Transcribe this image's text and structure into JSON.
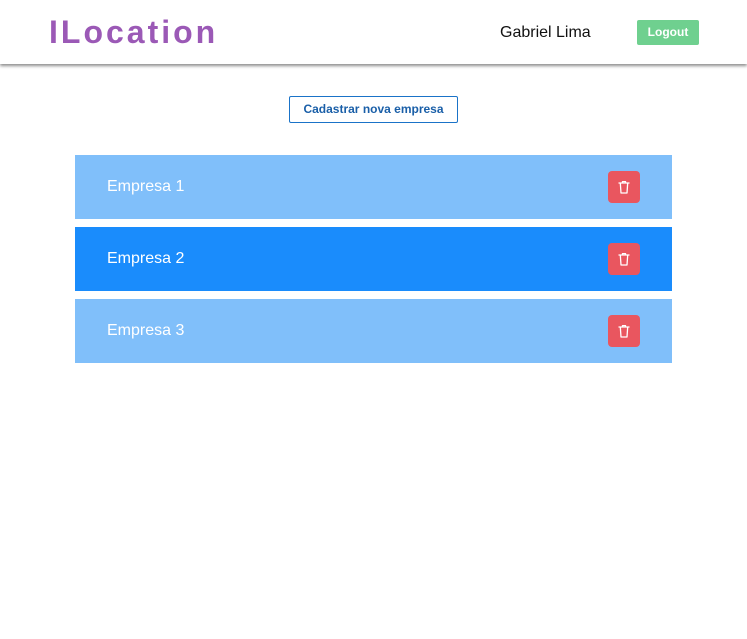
{
  "header": {
    "logo": "ILocation",
    "user_name": "Gabriel Lima",
    "logout_label": "Logout"
  },
  "actions": {
    "new_company_label": "Cadastrar nova empresa"
  },
  "companies": [
    {
      "name": "Empresa 1",
      "active": false,
      "delete_icon": "trash-icon"
    },
    {
      "name": "Empresa 2",
      "active": true,
      "delete_icon": "trash-icon"
    },
    {
      "name": "Empresa 3",
      "active": false,
      "delete_icon": "trash-icon"
    }
  ],
  "colors": {
    "logo": "#9b59b6",
    "logout": "#6fd08f",
    "item": "#80bffa",
    "item_active": "#1a8cfc",
    "delete": "#e9565f",
    "outline_button": "#1a73c8"
  }
}
